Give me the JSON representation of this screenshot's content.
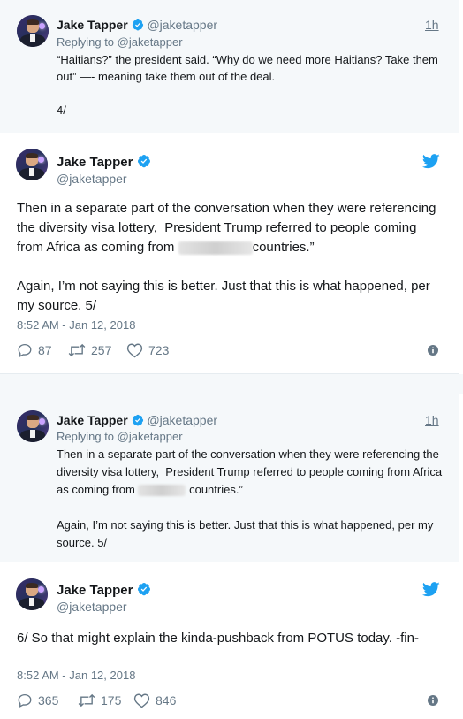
{
  "tweets": [
    {
      "name": "Jake Tapper",
      "handle": "@jaketapper",
      "time": "1h",
      "replying_to": "Replying to @jaketapper",
      "text": "“Haitians?” the president said. “Why do we need more Haitians? Take them out” —- meaning take them out of the deal.\n\n4/"
    },
    {
      "name": "Jake Tapper",
      "handle": "@jaketapper",
      "text_before": "Then in a separate part of the conversation when they were referencing the diversity visa lottery,  President Trump referred to people coming from Africa as coming from ",
      "text_after": "countries.”",
      "text_para2": "Again, I’m not saying this is better. Just that this is what happened, per my source. 5/",
      "timestamp": "8:52 AM - Jan 12, 2018",
      "replies": "87",
      "retweets": "257",
      "likes": "723"
    },
    {
      "name": "Jake Tapper",
      "handle": "@jaketapper",
      "time": "1h",
      "replying_to": "Replying to @jaketapper",
      "text_before": "Then in a separate part of the conversation when they were referencing the diversity visa lottery,  President Trump referred to people coming from Africa as coming from ",
      "text_after": " countries.”",
      "text_para2": "Again, I’m not saying this is better. Just that this is what happened, per my source. 5/"
    },
    {
      "name": "Jake Tapper",
      "handle": "@jaketapper",
      "text": "6/ So that might explain the kinda-pushback from POTUS today. -fin-",
      "timestamp": "8:52 AM - Jan 12, 2018",
      "replies": "365",
      "retweets": "175",
      "likes": "846"
    }
  ],
  "colors": {
    "twitter_blue": "#1da1f2",
    "verified_blue": "#1da1f2",
    "muted": "#657786",
    "reply_bg": "#f5f8fa"
  },
  "icons": [
    "verified-badge-icon",
    "twitter-bird-icon",
    "reply-icon",
    "retweet-icon",
    "like-heart-icon",
    "info-icon"
  ]
}
